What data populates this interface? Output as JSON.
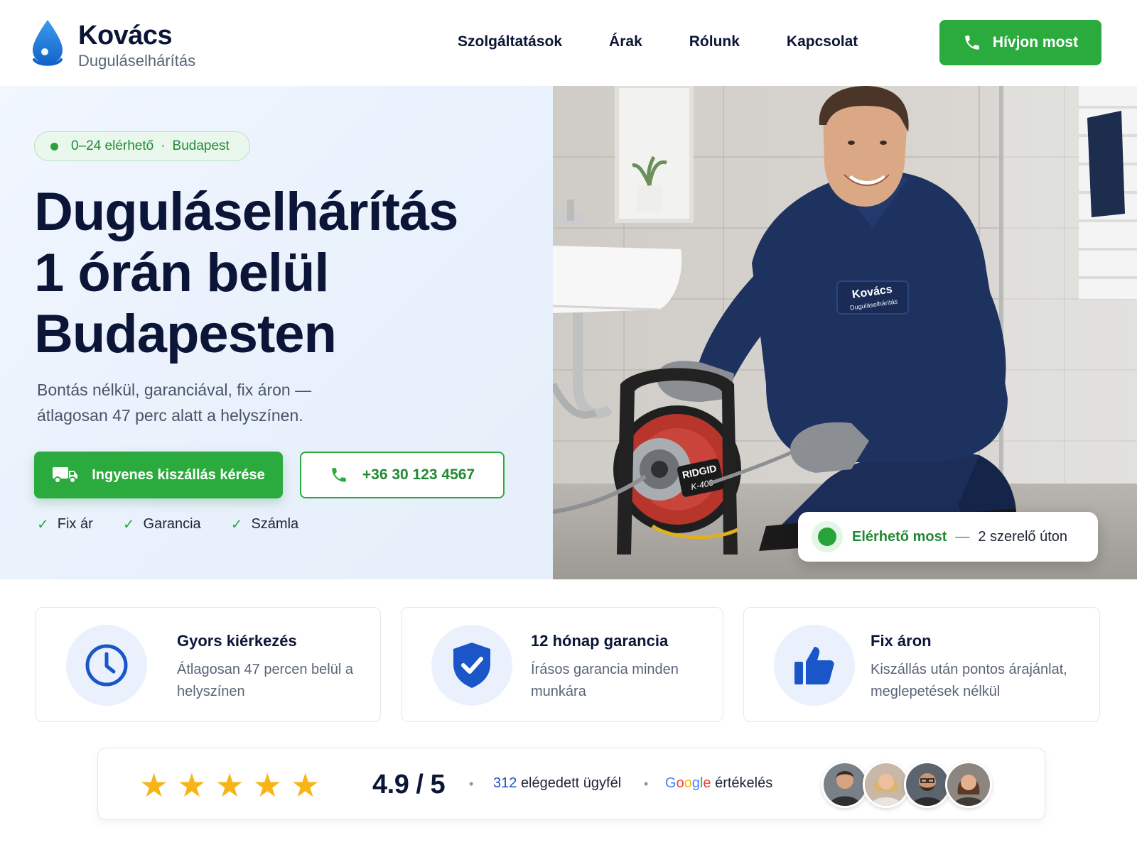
{
  "brand": {
    "name": "Kovács",
    "subtitle": "Duguláselhárítás"
  },
  "nav": {
    "items": [
      "Szolgáltatások",
      "Árak",
      "Rólunk",
      "Kapcsolat"
    ]
  },
  "header_cta": {
    "label": "Hívjon most",
    "icon": "phone-icon"
  },
  "hero": {
    "badge": {
      "availability": "0–24 elérhető",
      "separator": "·",
      "city": "Budapest"
    },
    "title_lines": [
      "Duguláselhárítás",
      "1 órán belül",
      "Budapesten"
    ],
    "subtitle": "Bontás nélkül, garanciával, fix áron — átlagosan 47 perc alatt a helyszínen.",
    "primary_button": {
      "label": "Ingyenes kiszállás kérése",
      "icon": "truck-icon"
    },
    "phone_button": {
      "label": "+36 30 123 4567",
      "icon": "phone-icon"
    },
    "checks": [
      "Fix ár",
      "Garancia",
      "Számla"
    ],
    "availability_card": {
      "status": "Elérhető most",
      "dash": "—",
      "detail": "2 szerelő úton"
    },
    "photo_text": {
      "shirt_name": "Kovács",
      "shirt_sub": "Duguláselhárítás",
      "machine_brand": "RIDGID",
      "machine_model": "K-400"
    }
  },
  "features": [
    {
      "icon": "clock-icon",
      "title": "Gyors kiérkezés",
      "description": "Átlagosan 47 percen belül a helyszínen"
    },
    {
      "icon": "shield-check-icon",
      "title": "12 hónap garancia",
      "description": "Írásos garancia minden munkára"
    },
    {
      "icon": "thumbs-up-icon",
      "title": "Fix áron",
      "description": "Kiszállás után pontos árajánlat, meglepetések nélkül"
    }
  ],
  "rating": {
    "stars": 5,
    "score": "4.9 / 5",
    "bullet": "•",
    "customers_count": "312",
    "customers_label": "elégedett ügyfél",
    "google_letters": [
      "G",
      "o",
      "o",
      "g",
      "l",
      "e"
    ],
    "google_label": "értékelés",
    "avatar_count": 4
  },
  "colors": {
    "primary_green": "#2bab3d",
    "navy": "#0b1537",
    "accent_blue": "#1a56c8",
    "star": "#f7b417"
  }
}
